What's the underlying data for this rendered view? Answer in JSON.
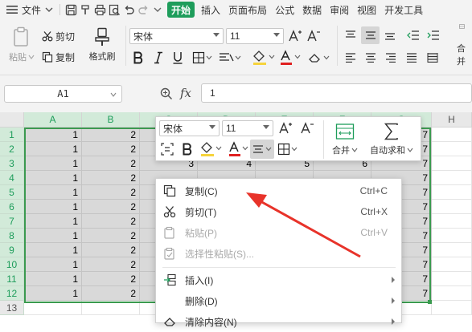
{
  "menubar": {
    "file_label": "文件",
    "tabs": [
      {
        "label": "开始",
        "active": true
      },
      {
        "label": "插入",
        "active": false
      },
      {
        "label": "页面布局",
        "active": false
      },
      {
        "label": "公式",
        "active": false
      },
      {
        "label": "数据",
        "active": false
      },
      {
        "label": "审阅",
        "active": false
      },
      {
        "label": "视图",
        "active": false
      },
      {
        "label": "开发工具",
        "active": false
      }
    ]
  },
  "ribbon": {
    "paste_label": "粘贴",
    "cut_label": "剪切",
    "copy_label": "复制",
    "format_painter_label": "格式刷",
    "font_name": "宋体",
    "font_size": "11",
    "merge_label": "合并"
  },
  "formula_bar": {
    "name_box": "A1",
    "fx_label": "fx",
    "value": "1"
  },
  "sheet": {
    "columns": [
      "A",
      "B",
      "C",
      "D",
      "E",
      "F",
      "G",
      "H"
    ],
    "rows": [
      "1",
      "2",
      "3",
      "4",
      "5",
      "6",
      "7",
      "8",
      "9",
      "10",
      "11",
      "12",
      "13"
    ],
    "row3_values": [
      "3",
      "4",
      "5",
      "6"
    ]
  },
  "mini_toolbar": {
    "font_name": "宋体",
    "font_size": "11",
    "merge_label": "合并",
    "autosum_label": "自动求和"
  },
  "context_menu": {
    "items": [
      {
        "label": "复制(C)",
        "shortcut": "Ctrl+C",
        "enabled": true
      },
      {
        "label": "剪切(T)",
        "shortcut": "Ctrl+X",
        "enabled": true
      },
      {
        "label": "粘贴(P)",
        "shortcut": "Ctrl+V",
        "enabled": false
      },
      {
        "label": "选择性粘贴(S)...",
        "shortcut": "",
        "enabled": false
      },
      {
        "label": "插入(I)",
        "shortcut": "",
        "enabled": true
      },
      {
        "label": "删除(D)",
        "shortcut": "",
        "enabled": true
      },
      {
        "label": "清除内容(N)",
        "shortcut": "",
        "enabled": true
      }
    ]
  },
  "colors": {
    "accent": "#1e9d5b",
    "selection_border": "#3a9a4f",
    "annotation_arrow": "#e8332a"
  }
}
